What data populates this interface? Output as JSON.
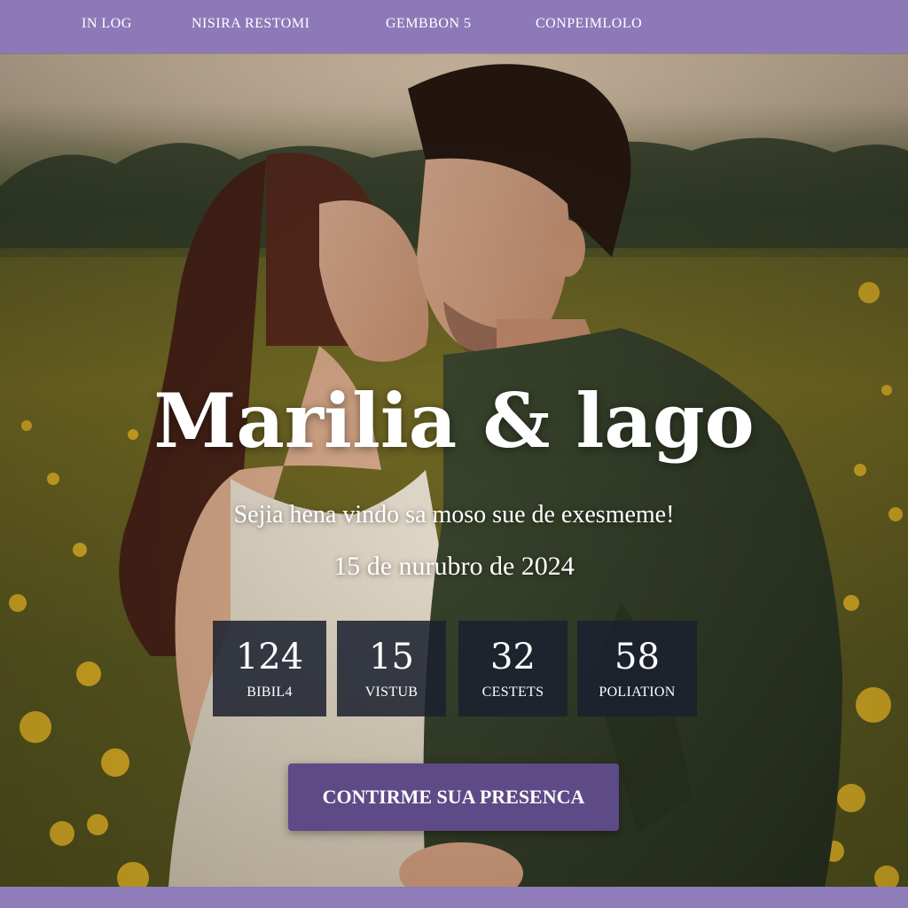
{
  "nav": {
    "items": [
      {
        "label": "IN LOG"
      },
      {
        "label": "NISIRA RESTOMI"
      },
      {
        "label": "GEMBBON 5"
      },
      {
        "label": "CONPEIMLOLO"
      }
    ]
  },
  "hero": {
    "title": "Marilia & lago",
    "welcome": "Sejia hena vindo sa moso sue de exesmeme!",
    "date": "15 de nurubro de 2024",
    "photo_icon": "couple-photo"
  },
  "countdown": [
    {
      "value": "124",
      "label": "BIBIL4"
    },
    {
      "value": "15",
      "label": "VISTUB"
    },
    {
      "value": "32",
      "label": "CESTETS"
    },
    {
      "value": "58",
      "label": "POLIATION"
    }
  ],
  "rsvp": {
    "label": "CONTIRME SUA PRESENCA"
  },
  "colors": {
    "nav_background": "#8d79b8",
    "button_background": "#5d4a87",
    "countdown_background": "#1b212e",
    "flower_yellow": "#e2b526"
  }
}
